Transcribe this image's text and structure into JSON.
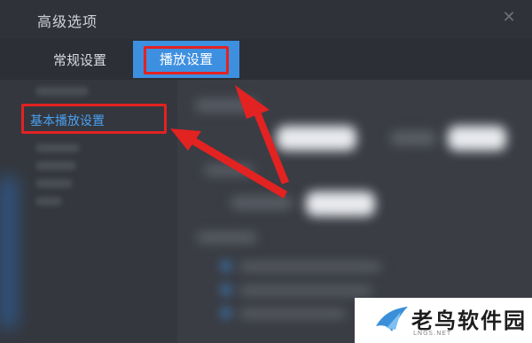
{
  "window": {
    "title": "高级选项"
  },
  "tabs": [
    {
      "label": "常规设置",
      "active": false
    },
    {
      "label": "播放设置",
      "active": true
    }
  ],
  "sidebar": {
    "items": [
      {
        "label": "基本播放设置",
        "active": true
      }
    ]
  },
  "watermark": {
    "name": "老鸟软件园",
    "sub": "LNGS.NET"
  },
  "colors": {
    "accent": "#3d8fe0",
    "highlight": "#e32222",
    "arrow": "#e32222",
    "active_nav_text": "#4aa0f0",
    "background": "#3b3e45"
  }
}
